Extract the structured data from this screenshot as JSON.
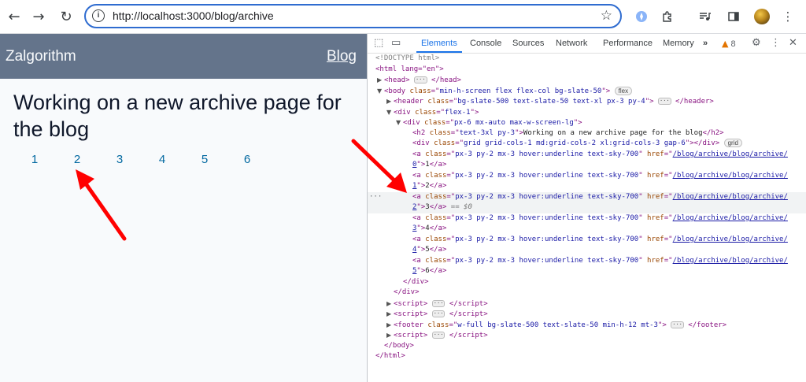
{
  "browser": {
    "url": "http://localhost:3000/blog/archive",
    "icons": [
      "back-arrow-icon",
      "forward-arrow-icon",
      "reload-icon",
      "site-info-icon",
      "bookmark-star-icon",
      "extension-icon",
      "puzzle-icon",
      "media-icon",
      "side-panel-icon",
      "profile-avatar",
      "kebab-menu-icon"
    ]
  },
  "page": {
    "site_name": "Zalgorithm",
    "nav_link": "Blog",
    "heading": "Working on a new archive page for the blog",
    "pages": [
      "1",
      "2",
      "3",
      "4",
      "5",
      "6"
    ],
    "colors": {
      "header_bg": "#64748b",
      "header_text": "#f8fafc",
      "body_bg": "#f8fafc",
      "link": "#0369a1",
      "arrow": "#ff0000"
    }
  },
  "devtools": {
    "tabs": [
      "Elements",
      "Console",
      "Sources",
      "Network",
      "Performance",
      "Memory"
    ],
    "active_tab": "Elements",
    "more_tabs": "»",
    "warning_count": "8",
    "lines": {
      "doctype": "<!DOCTYPE html>",
      "html_open": "<html lang=\"en\">",
      "head": "<head>",
      "head_close": "</head>",
      "body_class": "min-h-screen flex flex-col bg-slate-50",
      "body_badge": "flex",
      "header_class": "bg-slate-500 text-slate-50 text-xl px-3 py-4",
      "div1_class": "flex-1",
      "div2_class": "px-6 mx-auto max-w-screen-lg",
      "h2_class": "text-3xl py-3",
      "h2_text": "Working on a new archive page for the blog",
      "grid_class": "grid grid-cols-1 md:grid-cols-2 xl:grid-cols-3 gap-6",
      "grid_badge": "grid",
      "a_class": "px-3 py-2 mx-3 hover:underline text-sky-700",
      "href_prefix": "/blog/archive/blog/archive/",
      "links": [
        {
          "idx": "0",
          "text": "1"
        },
        {
          "idx": "1",
          "text": "2"
        },
        {
          "idx": "2",
          "text": "3"
        },
        {
          "idx": "3",
          "text": "4"
        },
        {
          "idx": "4",
          "text": "5"
        },
        {
          "idx": "5",
          "text": "6"
        }
      ],
      "selected_marker": "== $0",
      "footer_class": "w-full bg-slate-500 text-slate-50 min-h-12 mt-3"
    }
  }
}
